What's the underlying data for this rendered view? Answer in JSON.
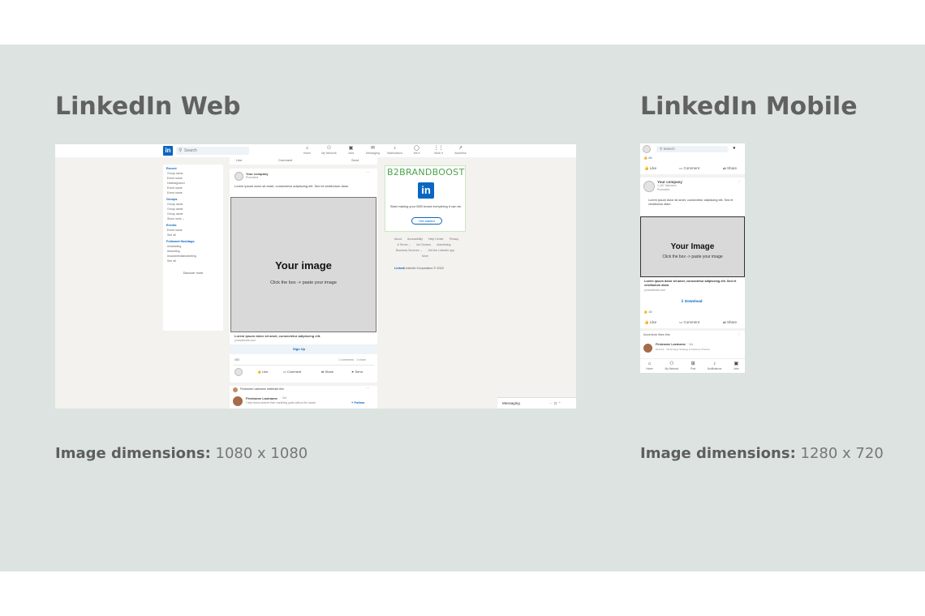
{
  "web_section": {
    "title": "LinkedIn Web",
    "dims_label": "Image dimensions:",
    "dims_value": "1080 x 1080"
  },
  "mobile_section": {
    "title": "LinkedIn Mobile",
    "dims_label": "Image dimensions:",
    "dims_value": "1280 x 720"
  },
  "web": {
    "logo": "in",
    "search_placeholder": "Search",
    "nav": [
      {
        "icon": "home-icon",
        "glyph": "⌂",
        "label": "Home"
      },
      {
        "icon": "network-icon",
        "glyph": "⚇",
        "label": "My Network"
      },
      {
        "icon": "jobs-icon",
        "glyph": "▣",
        "label": "Jobs"
      },
      {
        "icon": "messaging-icon",
        "glyph": "✉",
        "label": "Messaging"
      },
      {
        "icon": "notifications-icon",
        "glyph": "♪",
        "label": "Notifications"
      },
      {
        "icon": "me-icon",
        "glyph": "◯",
        "label": "Me ▾"
      },
      {
        "icon": "work-icon",
        "glyph": "⋮⋮",
        "label": "Work ▾"
      },
      {
        "icon": "advertise-icon",
        "glyph": "↗",
        "label": "Advertise"
      }
    ],
    "left": {
      "sections": [
        {
          "title": "Recent",
          "items": [
            "Group name",
            "Event name",
            "Hashtag/word",
            "Event name",
            "Event name"
          ]
        },
        {
          "title": "Groups",
          "items": [
            "Group name",
            "Group name",
            "Group name",
            "Show more ⌄"
          ]
        },
        {
          "title": "Events",
          "items": [
            "Event name",
            "See all"
          ]
        },
        {
          "title": "Followed Hashtags",
          "items": [
            "#marketing",
            "#branding",
            "#socialmediamarketing",
            "See all"
          ]
        }
      ],
      "discover": "Discover more"
    },
    "post": {
      "company": "Your company",
      "promoted": "Promoted",
      "text": "Lorem ipsum dolor sit amet, consectetur adipiscing elit. Sed et vestibulum diam.",
      "image_title": "Your image",
      "image_hint": "Click the box -> paste your image",
      "headline": "Lorem ipsum dolor sit amet, consectetur adipiscing elit.",
      "url": "yourwebsite.com",
      "cta": "Sign Up",
      "reactions": "453",
      "counts": "1 comments · 1 share",
      "actions": [
        "Like",
        "Comment",
        "Share",
        "Send"
      ]
    },
    "next_post": {
      "author_line": "Firstname Lastname celebrate this",
      "name": "Firstname Lastname",
      "degree": "· 3rd",
      "sub": "I help teams achieve their marketing goals without the hassle",
      "follow": "+ Follow"
    },
    "ad": {
      "brand": "B2BRANDBOOST",
      "logo": "in",
      "text": "Start making your B2B brand everything it can be.",
      "cta": "Get started"
    },
    "footer_links": [
      "About",
      "Accessibility",
      "Help Center",
      "Privacy & Terms ⌄",
      "Ad Choices",
      "Advertising",
      "Business Services ⌄",
      "Get the LinkedIn app",
      "More"
    ],
    "copyright": "LinkedIn Corporation © 2022",
    "messaging": "Messaging"
  },
  "mobile": {
    "search_placeholder": "Search",
    "reactions_top": "26",
    "top_actions": [
      "Like",
      "Comment",
      "Share"
    ],
    "company": "Your company",
    "followers": "1,467 followers",
    "promoted": "Promoted",
    "text": "Lorem ipsum dolor sit amet, consectetur adipiscing elit. Sed et vestibulum diam.",
    "image_title": "Your Image",
    "image_hint": "Click the box -> paste your image",
    "headline": "Lorem ipsum dolor sit amet, consectetur adipiscing elit. Sed et vestibulum diam.",
    "url": "yourwebsite.com",
    "cta": "Download",
    "reactions": "16",
    "actions": [
      "Like",
      "Comment",
      "Share"
    ],
    "next_head": "Accenture likes this",
    "name": "Firstname Lastname",
    "degree": "· 3rd",
    "sub": "Director · Technology Strategy & Advisory Practice",
    "tabs": [
      {
        "icon": "home-icon",
        "glyph": "⌂",
        "label": "Home"
      },
      {
        "icon": "network-icon",
        "glyph": "⚇",
        "label": "My Network"
      },
      {
        "icon": "post-icon",
        "glyph": "⊞",
        "label": "Post"
      },
      {
        "icon": "notifications-icon",
        "glyph": "♪",
        "label": "Notifications"
      },
      {
        "icon": "jobs-icon",
        "glyph": "▣",
        "label": "Jobs"
      }
    ]
  }
}
